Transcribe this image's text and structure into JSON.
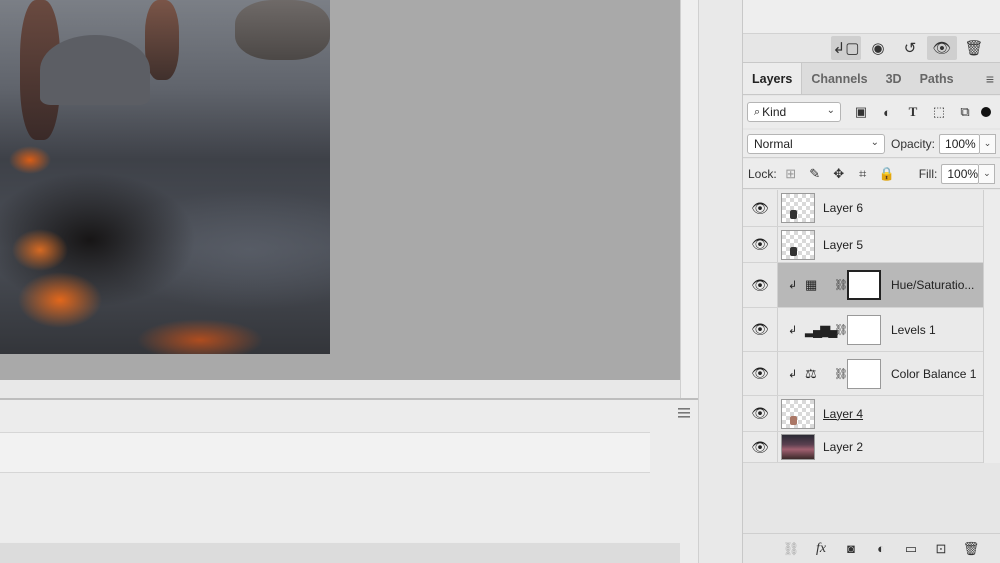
{
  "top_icons": [
    {
      "name": "clip-to-layer-icon",
      "glyph": "↲▢",
      "active": true
    },
    {
      "name": "view-previous-state-icon",
      "glyph": "◉",
      "active": false
    },
    {
      "name": "reset-adjustment-icon",
      "glyph": "↺",
      "active": false
    },
    {
      "name": "toggle-visibility-icon",
      "glyph": "👁",
      "active": true
    },
    {
      "name": "delete-adjustment-icon",
      "glyph": "🗑",
      "active": false
    }
  ],
  "tabs": [
    {
      "label": "Layers",
      "active": true
    },
    {
      "label": "Channels",
      "active": false
    },
    {
      "label": "3D",
      "active": false
    },
    {
      "label": "Paths",
      "active": false
    }
  ],
  "filter": {
    "kind_label": "Kind",
    "icons": [
      "image-filter-icon",
      "adjustment-filter-icon",
      "type-filter-icon",
      "shape-filter-icon",
      "smart-object-filter-icon"
    ]
  },
  "blend": {
    "mode": "Normal",
    "opacity_label": "Opacity:",
    "opacity_value": "100%"
  },
  "lock": {
    "label": "Lock:",
    "fill_label": "Fill:",
    "fill_value": "100%"
  },
  "layers": [
    {
      "name": "Layer 6",
      "kind": "pixel"
    },
    {
      "name": "Layer 5",
      "kind": "pixel"
    },
    {
      "name": "Hue/Saturatio...",
      "kind": "adjustment",
      "adj": "hue-saturation",
      "selected": true
    },
    {
      "name": "Levels 1",
      "kind": "adjustment",
      "adj": "levels"
    },
    {
      "name": "Color Balance 1",
      "kind": "adjustment",
      "adj": "color-balance"
    },
    {
      "name": "Layer 4",
      "kind": "pixel"
    },
    {
      "name": "Layer 2",
      "kind": "photo"
    }
  ],
  "bottom_bar_icons": [
    "link-layers-icon",
    "fx-icon",
    "add-mask-icon",
    "new-adjustment-icon",
    "new-group-icon",
    "new-layer-icon",
    "delete-layer-icon"
  ],
  "fx_label": "fx"
}
